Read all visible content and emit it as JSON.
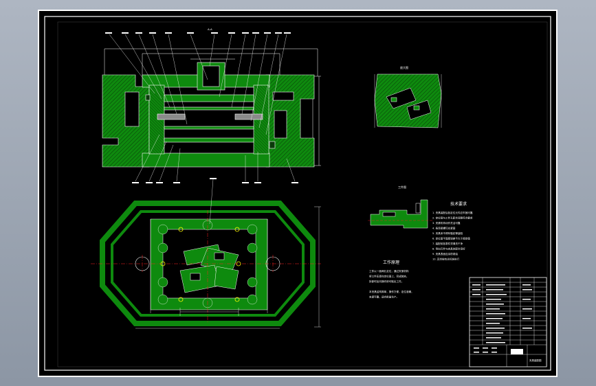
{
  "drawing": {
    "section_label": "A-A",
    "detail_label": "放大图",
    "partial_view_label": "工件图",
    "technical_requirements": {
      "title": "技术要求",
      "items": [
        "1. 夹具装配后各定位元件应牢固可靠",
        "2. 定位销与工件孔配合间隙符合要求",
        "3. 夹紧机构动作灵活可靠",
        "4. 各连接螺钉应紧固",
        "5. 夹具体不得有裂纹等缺陷",
        "6. 定位面平面度误差不大于规定值",
        "7. 装配前各零件须清洗干净",
        "8. 导向元件与夹具体配合良好",
        "9. 夹具表面应涂防锈油",
        "10. 其余按有关标准执行"
      ]
    },
    "working_principle": {
      "title": "工作原理",
      "lines": [
        "工件以一面两孔定位，通过夹紧机构",
        "将工件压紧在定位面上，完成装夹。",
        "拆卸时反向操作即可取出工件。",
        "",
        "本夹具结构简单，操作方便，定位准确，",
        "夹紧可靠，适合批量生产。"
      ]
    },
    "title_block": {
      "drawing_title": "夹具装配图"
    },
    "colors": {
      "section_fill": "#0e8a0e",
      "hatch": "#0a3a0a",
      "outline": "#ffffff",
      "center_line": "#ff2020",
      "hole_marker": "#ffff00",
      "background": "#000000"
    }
  }
}
